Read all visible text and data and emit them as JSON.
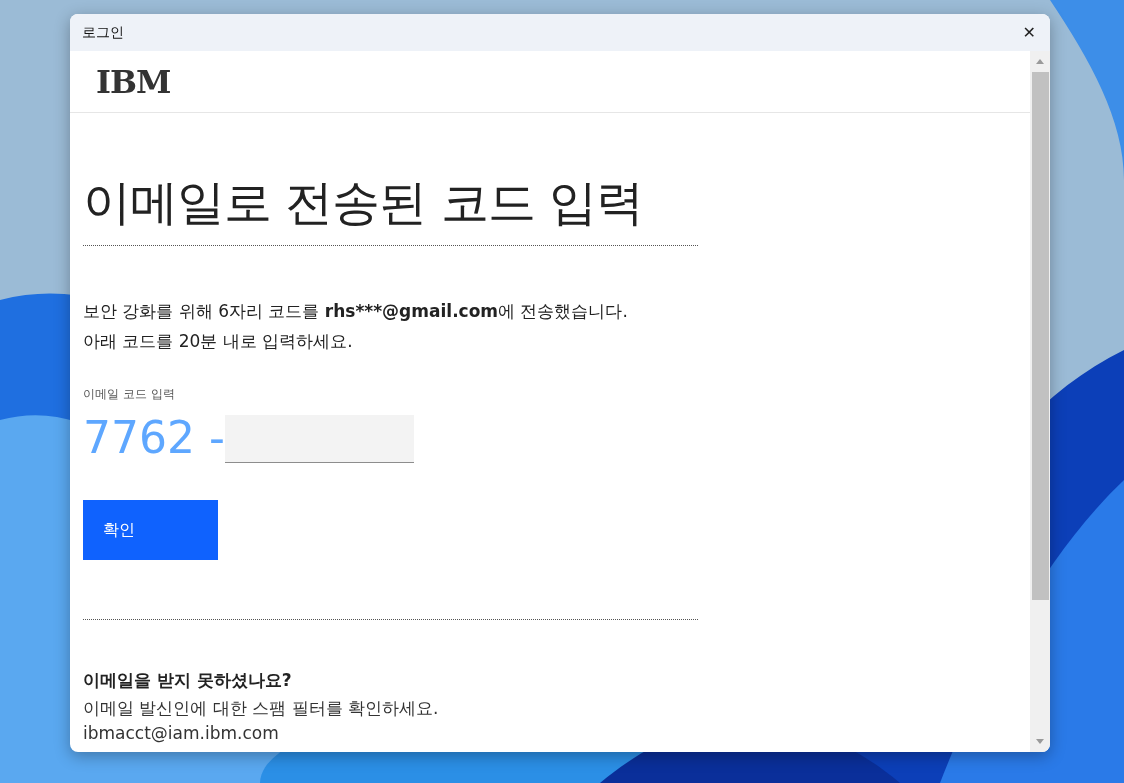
{
  "window": {
    "title": "로그인",
    "close": "✕"
  },
  "header": {
    "logo": "IBM"
  },
  "heading": "이메일로 전송된 코드 입력",
  "message": {
    "before": "보안 강화를 위해 6자리 코드를 ",
    "email": "rhs***@gmail.com",
    "after": "에 전송했습니다.",
    "line2": "아래 코드를 20분 내로 입력하세요."
  },
  "code_field": {
    "label": "이메일 코드 입력",
    "prefix": "7762 -"
  },
  "buttons": [
    "확인"
  ],
  "help": {
    "title": "이메일을 받지 못하셨나요?",
    "text": "이메일 발신인에 대한 스팸 필터를 확인하세요.",
    "email": "ibmacct@iam.ibm.com"
  }
}
